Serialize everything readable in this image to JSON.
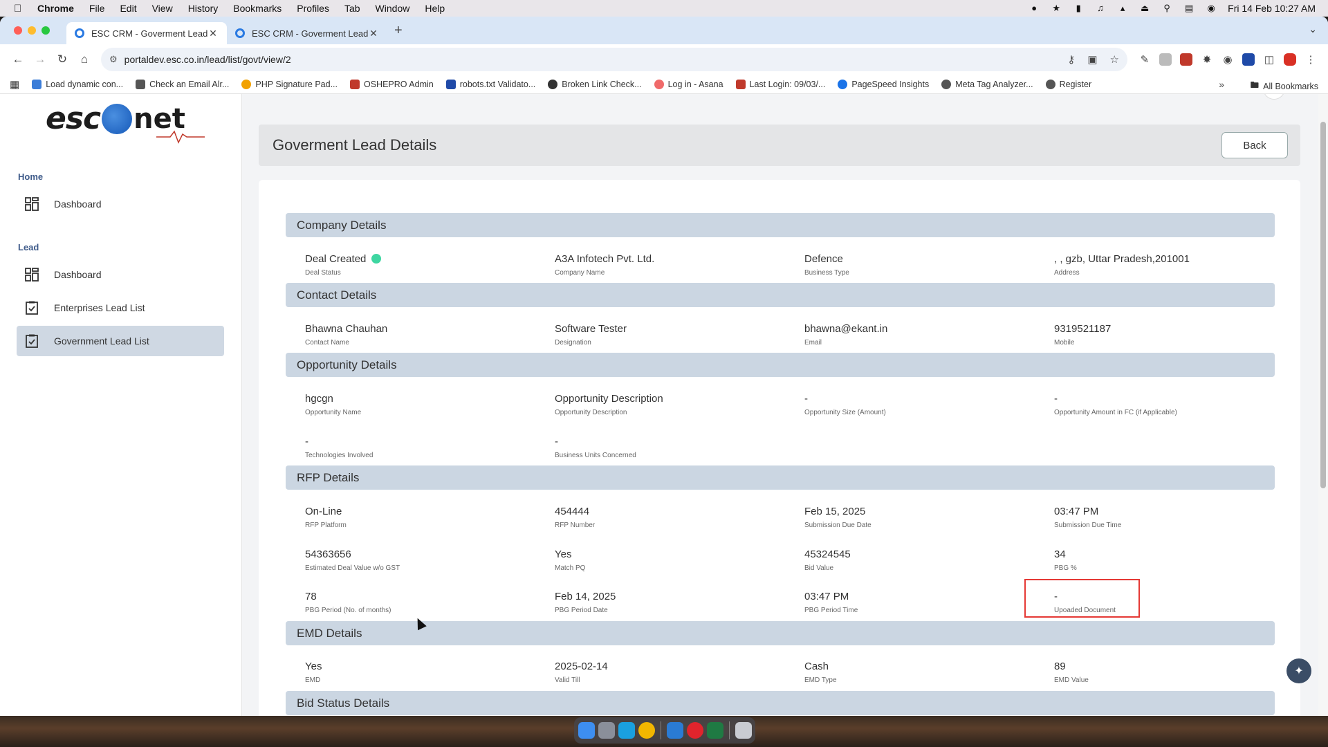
{
  "menubar": {
    "app_name": "Chrome",
    "items": [
      "File",
      "Edit",
      "View",
      "History",
      "Bookmarks",
      "Profiles",
      "Tab",
      "Window",
      "Help"
    ],
    "datetime": "Fri 14 Feb  10:27 AM"
  },
  "browser": {
    "tabs": [
      {
        "title": "ESC CRM - Goverment Lead"
      },
      {
        "title": "ESC CRM - Goverment Lead"
      }
    ],
    "url": "portaldev.esc.co.in/lead/list/govt/view/2",
    "bookmarks": [
      {
        "label": "Load dynamic con...",
        "color": "#3b7dd8"
      },
      {
        "label": "Check an Email Alr...",
        "color": "#555"
      },
      {
        "label": "PHP Signature Pad...",
        "color": "#f2a100"
      },
      {
        "label": "OSHEPRO Admin",
        "color": "#c0392b"
      },
      {
        "label": "robots.txt Validato...",
        "color": "#1f4aa8"
      },
      {
        "label": "Broken Link Check...",
        "color": "#333"
      },
      {
        "label": "Log in - Asana",
        "color": "#f06a6a"
      },
      {
        "label": "Last Login: 09/03/...",
        "color": "#c0392b"
      },
      {
        "label": "PageSpeed Insights",
        "color": "#1a73e8"
      },
      {
        "label": "Meta Tag Analyzer...",
        "color": "#555"
      },
      {
        "label": "Register",
        "color": "#555"
      }
    ],
    "all_bookmarks": "All Bookmarks"
  },
  "sidebar": {
    "logo_left": "esc",
    "logo_right": "net",
    "home_heading": "Home",
    "home_items": [
      {
        "label": "Dashboard"
      }
    ],
    "lead_heading": "Lead",
    "lead_items": [
      {
        "label": "Dashboard"
      },
      {
        "label": "Enterprises Lead List"
      },
      {
        "label": "Government Lead List"
      }
    ]
  },
  "page": {
    "title": "Goverment Lead Details",
    "back_label": "Back"
  },
  "sections": {
    "company": {
      "title": "Company Details",
      "fields": [
        {
          "value": "Deal Created",
          "label": "Deal Status"
        },
        {
          "value": "A3A Infotech Pvt. Ltd.",
          "label": "Company Name"
        },
        {
          "value": "Defence",
          "label": "Business Type"
        },
        {
          "value": ", , gzb, Uttar Pradesh,201001",
          "label": "Address"
        }
      ]
    },
    "contact": {
      "title": "Contact Details",
      "fields": [
        {
          "value": "Bhawna Chauhan",
          "label": "Contact Name"
        },
        {
          "value": "Software Tester",
          "label": "Designation"
        },
        {
          "value": "bhawna@ekant.in",
          "label": "Email"
        },
        {
          "value": "9319521187",
          "label": "Mobile"
        }
      ]
    },
    "opportunity": {
      "title": "Opportunity Details",
      "fields": [
        {
          "value": "hgcgn",
          "label": "Opportunity Name"
        },
        {
          "value": "Opportunity Description",
          "label": "Opportunity Description"
        },
        {
          "value": "-",
          "label": "Opportunity Size (Amount)"
        },
        {
          "value": "-",
          "label": "Opportunity Amount in FC (if Applicable)"
        },
        {
          "value": "-",
          "label": "Technologies Involved"
        },
        {
          "value": "-",
          "label": "Business Units Concerned"
        }
      ]
    },
    "rfp": {
      "title": "RFP Details",
      "fields": [
        {
          "value": "On-Line",
          "label": "RFP Platform"
        },
        {
          "value": "454444",
          "label": "RFP Number"
        },
        {
          "value": "Feb 15, 2025",
          "label": "Submission Due Date"
        },
        {
          "value": "03:47 PM",
          "label": "Submission Due Time"
        },
        {
          "value": "54363656",
          "label": "Estimated Deal Value w/o GST"
        },
        {
          "value": "Yes",
          "label": "Match PQ"
        },
        {
          "value": "45324545",
          "label": "Bid Value"
        },
        {
          "value": "34",
          "label": "PBG %"
        },
        {
          "value": "78",
          "label": "PBG Period (No. of months)"
        },
        {
          "value": "Feb 14, 2025",
          "label": "PBG Period Date"
        },
        {
          "value": "03:47 PM",
          "label": "PBG Period Time"
        },
        {
          "value": "-",
          "label": "Upoaded Document"
        }
      ]
    },
    "emd": {
      "title": "EMD Details",
      "fields": [
        {
          "value": "Yes",
          "label": "EMD"
        },
        {
          "value": "2025-02-14",
          "label": "Valid Till"
        },
        {
          "value": "Cash",
          "label": "EMD Type"
        },
        {
          "value": "89",
          "label": "EMD Value"
        }
      ]
    },
    "bid_status": {
      "title": "Bid Status Details"
    }
  },
  "colors": {
    "status_dot": "#3ed6a1",
    "section_header": "#cbd6e2",
    "active_nav": "#cfd8e3",
    "highlight_border": "#e53935"
  }
}
